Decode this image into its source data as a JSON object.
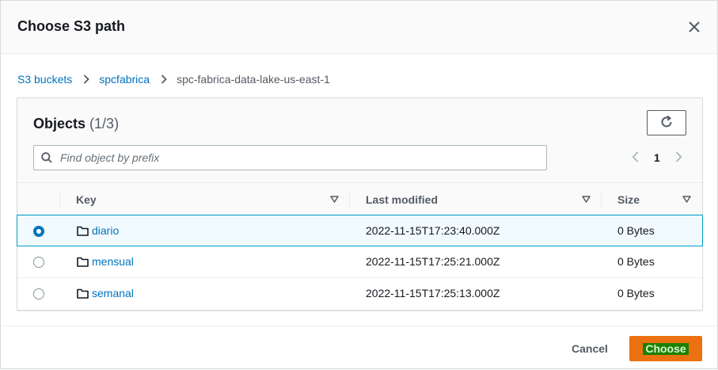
{
  "modal": {
    "title": "Choose S3 path"
  },
  "breadcrumb": {
    "items": [
      "S3 buckets",
      "spcfabrica"
    ],
    "current": "spc-fabrica-data-lake-us-east-1"
  },
  "objects": {
    "title": "Objects",
    "count": "(1/3)",
    "search_placeholder": "Find object by prefix",
    "search_value": "",
    "page": "1"
  },
  "table": {
    "columns": [
      "Key",
      "Last modified",
      "Size"
    ],
    "rows": [
      {
        "key": "diario",
        "modified": "2022-11-15T17:23:40.000Z",
        "size": "0 Bytes",
        "selected": true
      },
      {
        "key": "mensual",
        "modified": "2022-11-15T17:25:21.000Z",
        "size": "0 Bytes",
        "selected": false
      },
      {
        "key": "semanal",
        "modified": "2022-11-15T17:25:13.000Z",
        "size": "0 Bytes",
        "selected": false
      }
    ]
  },
  "footer": {
    "cancel_label": "Cancel",
    "choose_label": "Choose"
  },
  "icons": {
    "close": "close-icon",
    "breadcrumb_separator": "chevron-right-icon",
    "refresh": "refresh-icon",
    "search": "search-icon",
    "prev_page": "chevron-left-icon",
    "next_page": "chevron-right-icon",
    "sort": "caret-down-icon",
    "folder": "folder-icon"
  },
  "colors": {
    "link": "#0073bb",
    "primary_button": "#ec7211",
    "selected_row_bg": "#f1faff",
    "selected_row_border": "#00a1c9"
  }
}
